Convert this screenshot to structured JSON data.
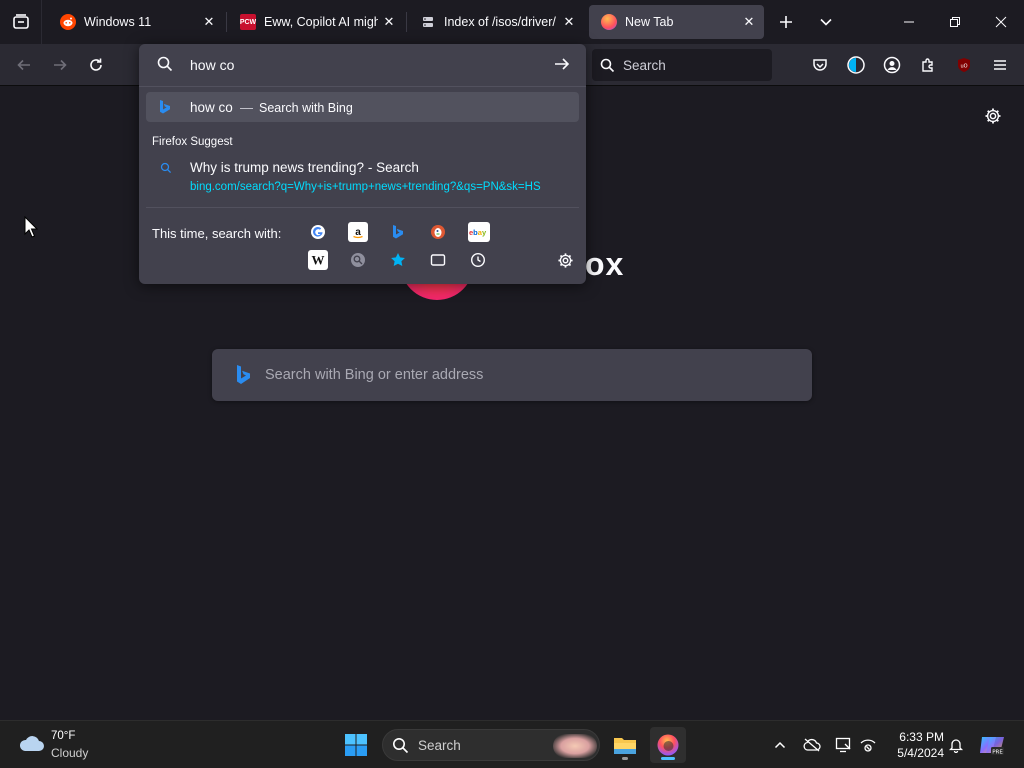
{
  "tabs": [
    {
      "title": "Windows 11",
      "favicon": "reddit-icon",
      "active": false
    },
    {
      "title": "Eww, Copilot AI might",
      "favicon": "pcworld-icon",
      "favicon_text": "PCW",
      "active": false
    },
    {
      "title": "Index of /isos/driver/",
      "favicon": "server-icon",
      "active": false
    },
    {
      "title": "New Tab",
      "favicon": "firefox-icon",
      "active": true
    }
  ],
  "toolbar": {
    "search_placeholder": "Search"
  },
  "urlbar": {
    "value": "how co",
    "heuristic": {
      "query": "how co",
      "separator": "—",
      "action": "Search with Bing"
    },
    "group_label": "Firefox Suggest",
    "suggestion": {
      "title": "Why is trump news trending? - Search",
      "url": "bing.com/search?q=Why+is+trump+news+trending?&qs=PN&sk=HS"
    },
    "oneoff_label": "This time, search with:",
    "engines": [
      "google-icon",
      "amazon-icon",
      "bing-icon",
      "duckduckgo-icon",
      "ebay-icon",
      "wikipedia-icon",
      "search-engine-icon",
      "bookmarks-icon",
      "tabs-icon",
      "history-icon"
    ]
  },
  "newtab": {
    "logo_text": "ox",
    "search_placeholder": "Search with Bing or enter address"
  },
  "taskbar": {
    "weather_temp": "70°F",
    "weather_cond": "Cloudy",
    "search_placeholder": "Search",
    "time": "6:33 PM",
    "date": "5/4/2024"
  },
  "colors": {
    "page_bg": "#1c1b22",
    "toolbar_bg": "#2b2a33",
    "panel_bg": "#42414d",
    "accent": "#00ddff",
    "taskbar_bg": "#202020"
  }
}
